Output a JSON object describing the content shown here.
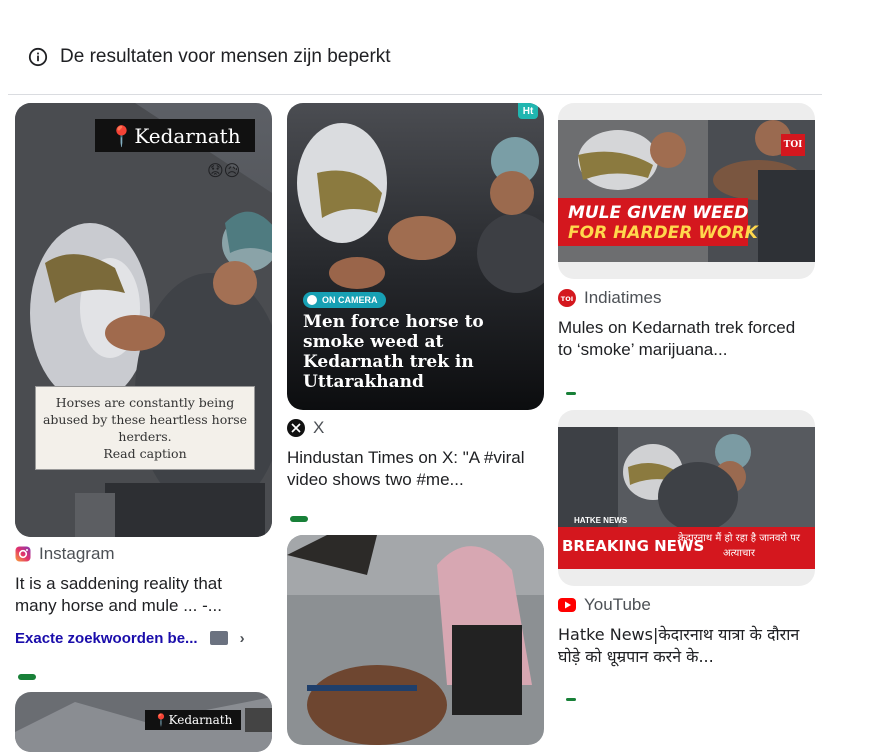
{
  "notice": {
    "text": "De resultaten voor mensen zijn beperkt",
    "icon": "info-icon"
  },
  "cards": {
    "instagram": {
      "overlay_tag": "📍Kedarnath",
      "overlay_emoji": "😟😥",
      "caption_box": "Horses are constantly being abused by these heartless horse herders.\nRead caption",
      "source": "Instagram",
      "title": "It is a saddening reality that many horse and mule ... -...",
      "chip_label": "Exacte zoekwoorden be...",
      "chip_chevron": "›"
    },
    "x": {
      "badge": "ON CAMERA",
      "headline": "Men force horse to smoke weed at Kedarnath trek in Uttarakhand",
      "corner_logo": "Ht",
      "source": "X",
      "title": "Hindustan Times on X: \"A #viral video shows two #me..."
    },
    "indiatimes": {
      "logo": "TOI",
      "banner_line1": "MULE GIVEN WEED",
      "banner_line2": "FOR HARDER WORK",
      "source": "Indiatimes",
      "title": "Mules on Kedarnath trek forced to ‘smoke’ marijuana..."
    },
    "youtube": {
      "tag": "HATKE NEWS",
      "breaking": "BREAKING NEWS",
      "hindi_banner": "केदारनाथ मैं हो रहा है जानवरो पर अत्याचार",
      "source": "YouTube",
      "title": "Hatke News|केदारनाथ यात्रा के दौरान घोड़े को धूम्रपान करने के..."
    },
    "instagram2": {
      "overlay_tag": "📍Kedarnath"
    }
  },
  "colors": {
    "accent_link": "#1a0dab",
    "breaking_red": "#d4171e",
    "banner_yellow": "#ffd84d",
    "youtube_red": "#ff0000",
    "toi_red": "#d4171e",
    "onCamera_teal": "#17a0b4"
  }
}
